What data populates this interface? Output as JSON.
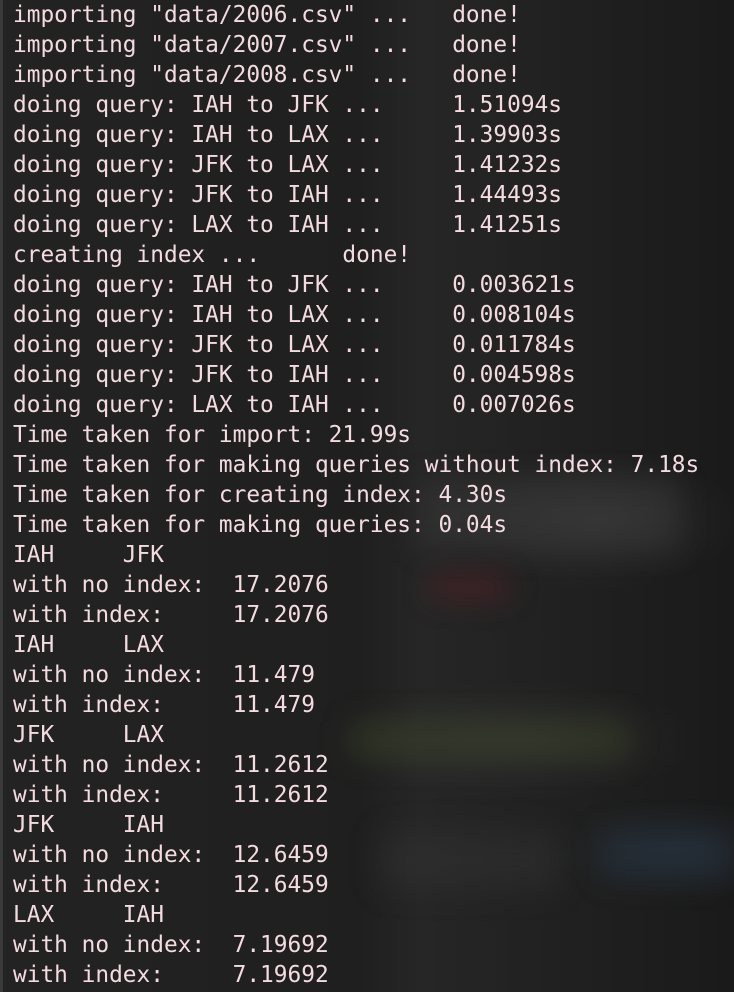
{
  "terminal": {
    "text_color": "#f4dbe0",
    "background_color": "#1f1f1f",
    "lines": [
      "importing \"data/2006.csv\" ...   done!",
      "importing \"data/2007.csv\" ...   done!",
      "importing \"data/2008.csv\" ...   done!",
      "doing query: IAH to JFK ...     1.51094s",
      "doing query: IAH to LAX ...     1.39903s",
      "doing query: JFK to LAX ...     1.41232s",
      "doing query: JFK to IAH ...     1.44493s",
      "doing query: LAX to IAH ...     1.41251s",
      "creating index ...      done!",
      "doing query: IAH to JFK ...     0.003621s",
      "doing query: IAH to LAX ...     0.008104s",
      "doing query: JFK to LAX ...     0.011784s",
      "doing query: JFK to IAH ...     0.004598s",
      "doing query: LAX to IAH ...     0.007026s",
      "Time taken for import: 21.99s",
      "Time taken for making queries without index: 7.18s",
      "Time taken for creating index: 4.30s",
      "Time taken for making queries: 0.04s",
      "IAH     JFK",
      "with no index:  17.2076",
      "with index:     17.2076",
      "IAH     LAX",
      "with no index:  11.479",
      "with index:     11.479",
      "JFK     LAX",
      "with no index:  11.2612",
      "with index:     11.2612",
      "JFK     IAH",
      "with no index:  12.6459",
      "with index:     12.6459",
      "LAX     IAH",
      "with no index:  7.19692",
      "with index:     7.19692"
    ]
  }
}
